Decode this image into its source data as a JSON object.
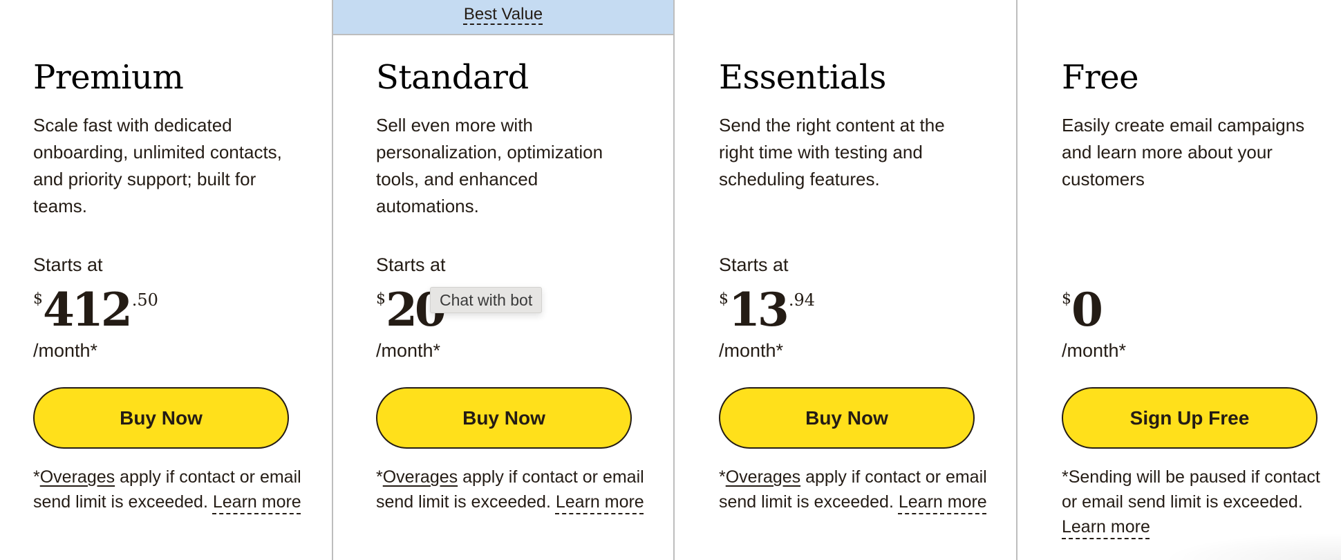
{
  "colors": {
    "cta_background": "#ffe01b",
    "text": "#241c15",
    "badge_background": "#c5dbf2",
    "divider": "#bdbdbd"
  },
  "tooltip": {
    "text": "Chat with bot"
  },
  "plans": [
    {
      "name": "Premium",
      "description": "Scale fast with dedicated onboarding, unlimited contacts, and priority support; built for teams.",
      "starts_at": "Starts at",
      "currency": "$",
      "amount": "412",
      "cents": ".50",
      "period": "/month*",
      "cta_label": "Buy Now",
      "footnote": {
        "prefix": "*",
        "link_label": "Overages",
        "text": " apply if contact or email send limit is exceeded. ",
        "learn_more": "Learn more"
      }
    },
    {
      "badge": "Best Value",
      "name": "Standard",
      "description": "Sell even more with personalization, optimization tools, and enhanced automations.",
      "starts_at": "Starts at",
      "currency": "$",
      "amount": "20",
      "cents": "",
      "period": "/month*",
      "cta_label": "Buy Now",
      "footnote": {
        "prefix": "*",
        "link_label": "Overages",
        "text": " apply if contact or email send limit is exceeded. ",
        "learn_more": "Learn more"
      }
    },
    {
      "name": "Essentials",
      "description": "Send the right content at the right time with testing and scheduling features.",
      "starts_at": "Starts at",
      "currency": "$",
      "amount": "13",
      "cents": ".94",
      "period": "/month*",
      "cta_label": "Buy Now",
      "footnote": {
        "prefix": "*",
        "link_label": "Overages",
        "text": " apply if contact or email send limit is exceeded. ",
        "learn_more": "Learn more"
      }
    },
    {
      "name": "Free",
      "description": "Easily create email campaigns and learn more about your customers",
      "starts_at": "",
      "currency": "$",
      "amount": "0",
      "cents": "",
      "period": "/month*",
      "cta_label": "Sign Up Free",
      "footnote": {
        "text": "*Sending will be paused if contact or email send limit is exceeded. ",
        "learn_more": "Learn more"
      }
    }
  ]
}
